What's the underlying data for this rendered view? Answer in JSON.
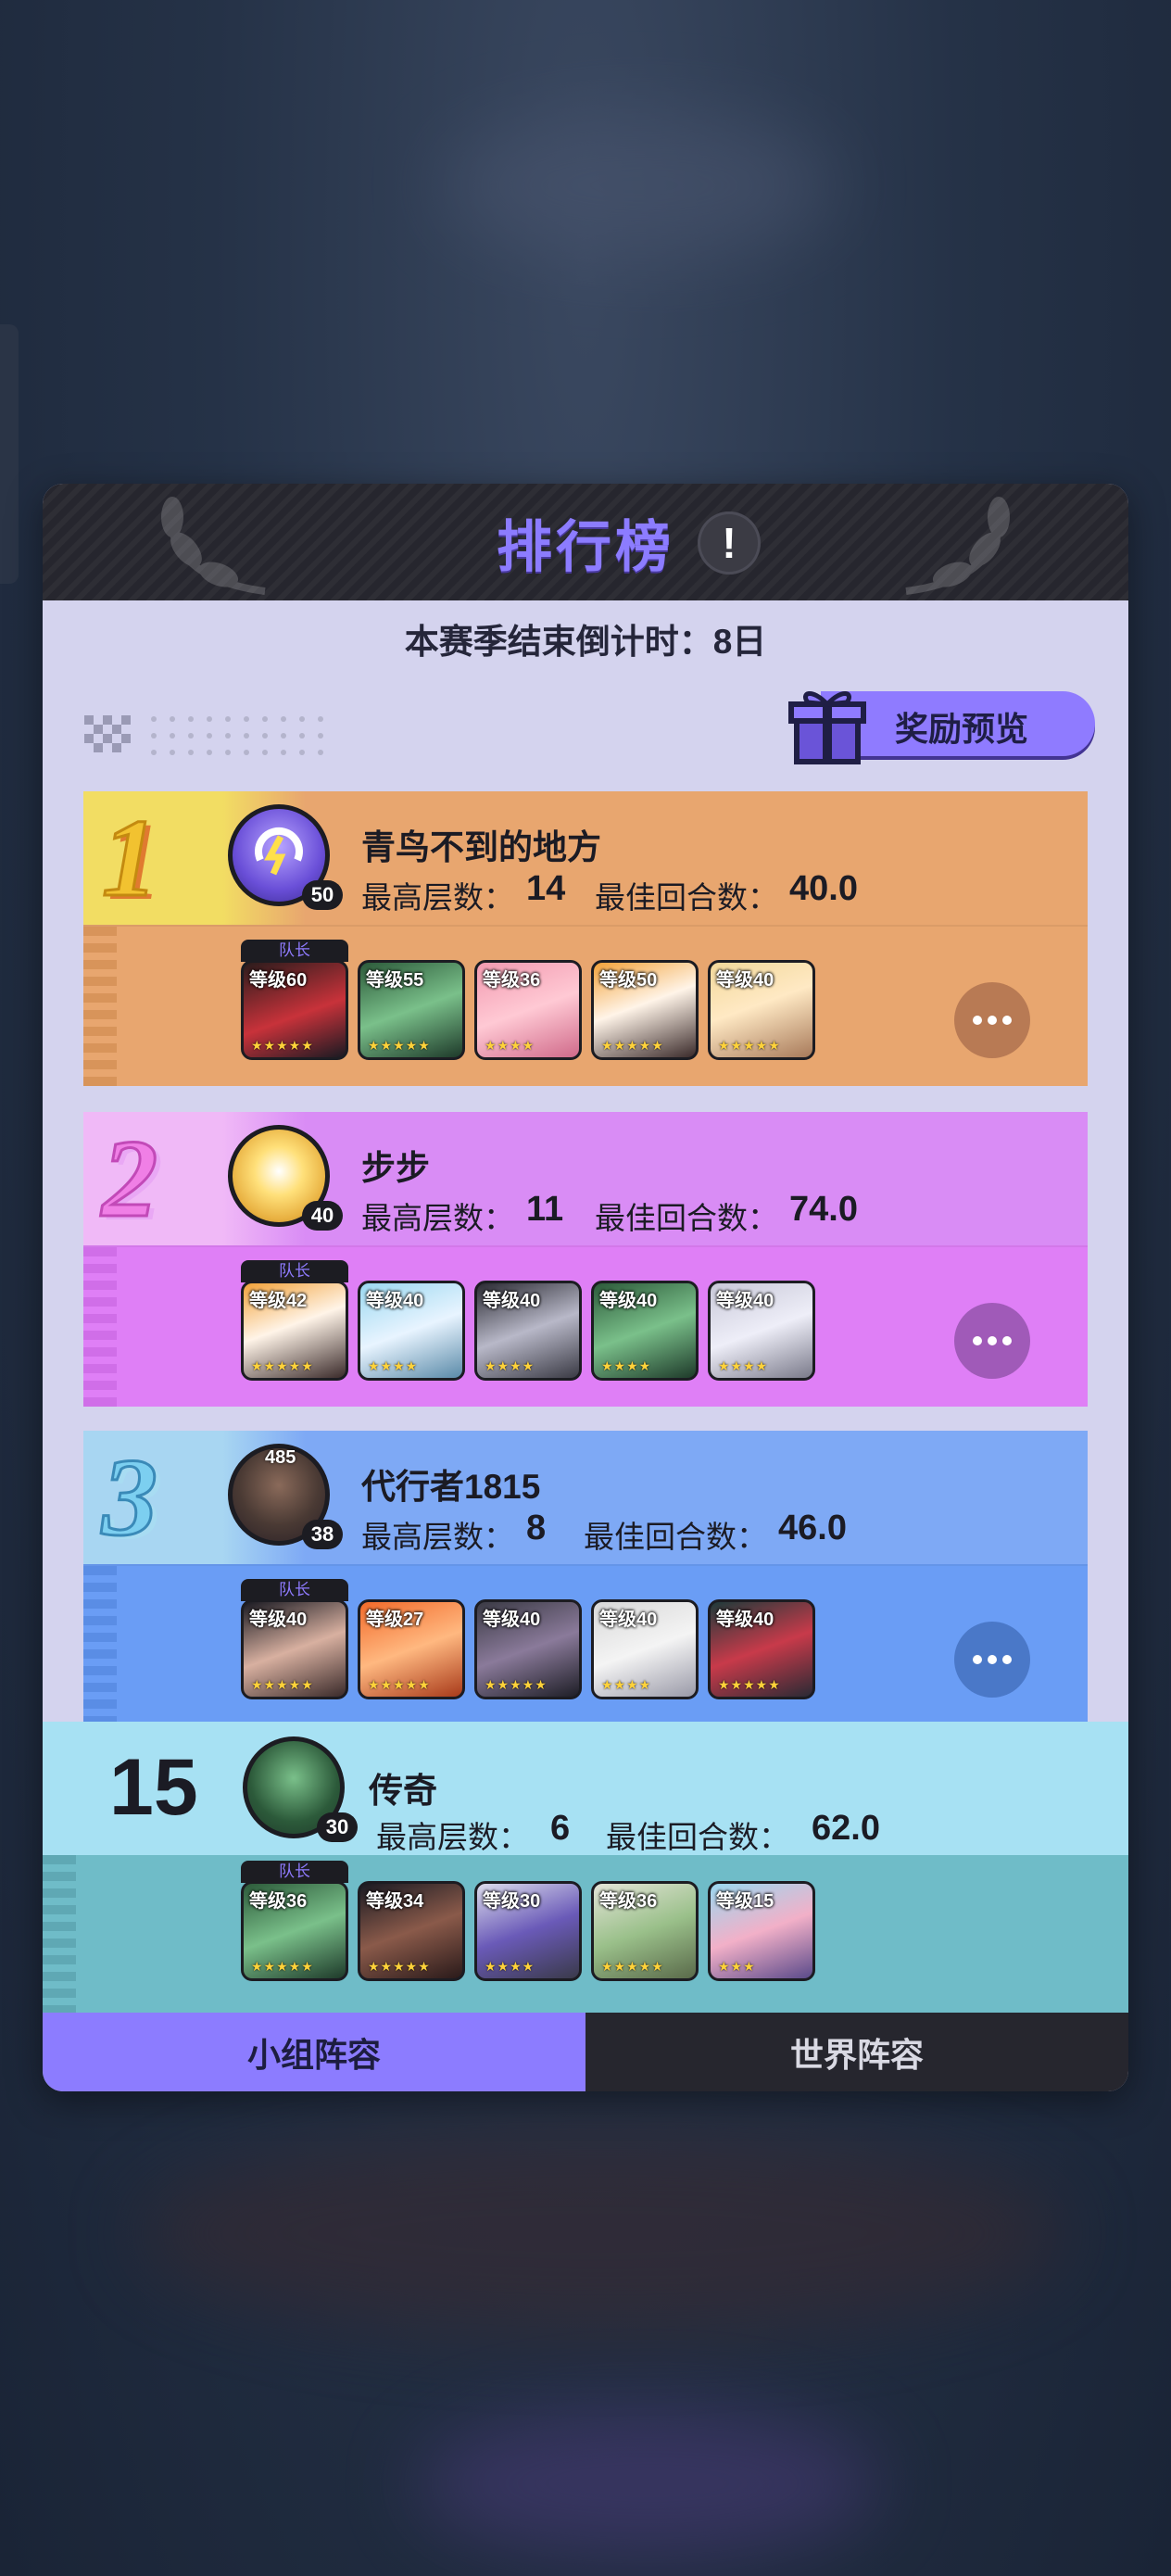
{
  "header": {
    "title": "排行榜",
    "info_icon": "exclamation-icon",
    "info_text": "!"
  },
  "countdown": "本赛季结束倒计时：8日",
  "reward_button": {
    "label": "奖励预览",
    "icon": "gift-icon"
  },
  "labels": {
    "max_floor": "最高层数：",
    "best_rounds": "最佳回合数：",
    "captain": "队长"
  },
  "ranks": [
    {
      "rank": "1",
      "name": "青鸟不到的地方",
      "player_level": "50",
      "max_floor": "14",
      "best_rounds": "40.0",
      "heroes": [
        {
          "level": "等级60",
          "captain": true
        },
        {
          "level": "等级55"
        },
        {
          "level": "等级36"
        },
        {
          "level": "等级50"
        },
        {
          "level": "等级40"
        }
      ],
      "colors": {
        "top": "#e8a66f",
        "bot": "#e8a66f",
        "left": "#f2dd63",
        "num": "#f2c230"
      }
    },
    {
      "rank": "2",
      "name": "步步",
      "player_level": "40",
      "max_floor": "11",
      "best_rounds": "74.0",
      "heroes": [
        {
          "level": "等级42",
          "captain": true
        },
        {
          "level": "等级40"
        },
        {
          "level": "等级40"
        },
        {
          "level": "等级40"
        },
        {
          "level": "等级40"
        }
      ],
      "colors": {
        "top": "#d98cf5",
        "bot": "#df7ff6",
        "left": "#f0b9f7",
        "num": "#f07fe6"
      }
    },
    {
      "rank": "3",
      "name": "代行者1815",
      "player_level": "38",
      "max_floor": "8",
      "best_rounds": "46.0",
      "avatar_badge": "485",
      "heroes": [
        {
          "level": "等级40",
          "captain": true
        },
        {
          "level": "等级27"
        },
        {
          "level": "等级40"
        },
        {
          "level": "等级40"
        },
        {
          "level": "等级40"
        }
      ],
      "colors": {
        "top": "#7ea9f5",
        "bot": "#6a9df5",
        "left": "#a8d6f2",
        "num": "#7ccff0"
      }
    },
    {
      "rank": "15",
      "name": "传奇",
      "player_level": "30",
      "max_floor": "6",
      "best_rounds": "62.0",
      "heroes": [
        {
          "level": "等级36",
          "captain": true
        },
        {
          "level": "等级34"
        },
        {
          "level": "等级30"
        },
        {
          "level": "等级36"
        },
        {
          "level": "等级15"
        }
      ],
      "colors": {
        "top": "#a7e1f3",
        "bot": "#6fbcc8",
        "left": "#a7e1f3",
        "num": "#1b1b24"
      }
    }
  ],
  "tabs": [
    {
      "label": "小组阵容",
      "active": true
    },
    {
      "label": "世界阵容",
      "active": false
    }
  ]
}
